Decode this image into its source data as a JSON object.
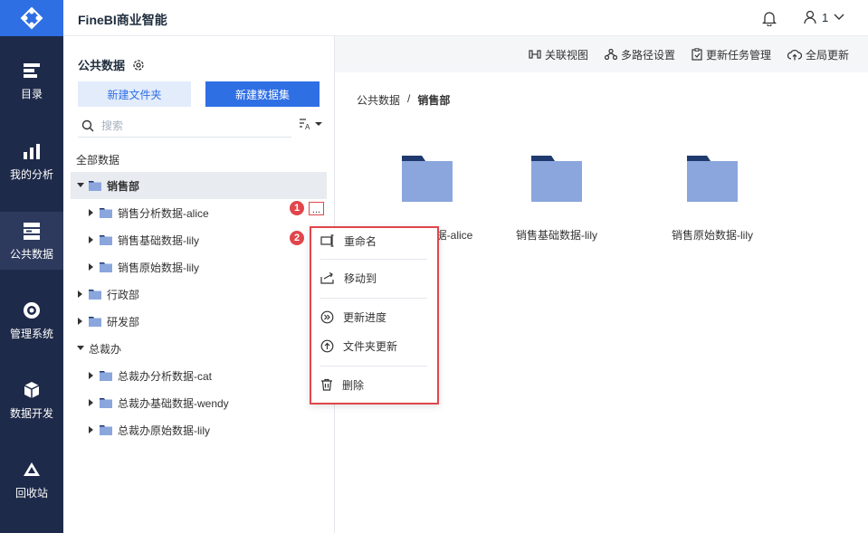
{
  "header": {
    "app_title": "FineBI商业智能",
    "user_name": "1"
  },
  "rail": {
    "items": [
      {
        "label": "目录",
        "icon": "catalog-icon"
      },
      {
        "label": "我的分析",
        "icon": "analysis-icon"
      },
      {
        "label": "公共数据",
        "icon": "public-data-icon",
        "active": true
      },
      {
        "label": "管理系统",
        "icon": "gear-icon"
      },
      {
        "label": "数据开发",
        "icon": "cube-icon"
      },
      {
        "label": "回收站",
        "icon": "recycle-icon"
      }
    ]
  },
  "left_panel": {
    "title": "公共数据",
    "new_folder_label": "新建文件夹",
    "new_dataset_label": "新建数据集",
    "search_placeholder": "搜索",
    "all_data_label": "全部数据",
    "tree": [
      {
        "label": "销售部",
        "level": 0,
        "expanded": true,
        "selected": true
      },
      {
        "label": "销售分析数据-alice",
        "level": 1,
        "expanded": false
      },
      {
        "label": "销售基础数据-lily",
        "level": 1,
        "expanded": false
      },
      {
        "label": "销售原始数据-lily",
        "level": 1,
        "expanded": false
      },
      {
        "label": "行政部",
        "level": 0,
        "expanded": false
      },
      {
        "label": "研发部",
        "level": 0,
        "expanded": false
      },
      {
        "label": "总裁办",
        "level": 0,
        "expanded": true
      },
      {
        "label": "总裁办分析数据-cat",
        "level": 1,
        "expanded": false
      },
      {
        "label": "总裁办基础数据-wendy",
        "level": 1,
        "expanded": false
      },
      {
        "label": "总裁办原始数据-lily",
        "level": 1,
        "expanded": false
      }
    ],
    "more_label": "..."
  },
  "badges": [
    "1",
    "2"
  ],
  "toolbar": {
    "items": [
      {
        "label": "关联视图",
        "icon": "relation-view-icon"
      },
      {
        "label": "多路径设置",
        "icon": "multi-path-icon"
      },
      {
        "label": "更新任务管理",
        "icon": "task-icon"
      },
      {
        "label": "全局更新",
        "icon": "cloud-update-icon"
      }
    ]
  },
  "breadcrumb": {
    "root": "公共数据",
    "separator": "/",
    "current": "销售部"
  },
  "cards": [
    {
      "label": "销售分析数据-alice",
      "visible_label": "据-alice"
    },
    {
      "label": "销售基础数据-lily"
    },
    {
      "label": "销售原始数据-lily"
    }
  ],
  "context_menu": {
    "items": [
      {
        "label": "重命名",
        "icon": "rename-icon"
      },
      {
        "label": "移动到",
        "icon": "move-icon"
      },
      {
        "label": "更新进度",
        "icon": "progress-icon"
      },
      {
        "label": "文件夹更新",
        "icon": "folder-update-icon"
      },
      {
        "label": "删除",
        "icon": "trash-icon"
      }
    ]
  },
  "colors": {
    "accent": "#2f6fe4",
    "rail_bg": "#1e2a49",
    "folder": "#8aa6dd",
    "folder_tab": "#1f3a6e",
    "highlight": "#e0464b"
  }
}
